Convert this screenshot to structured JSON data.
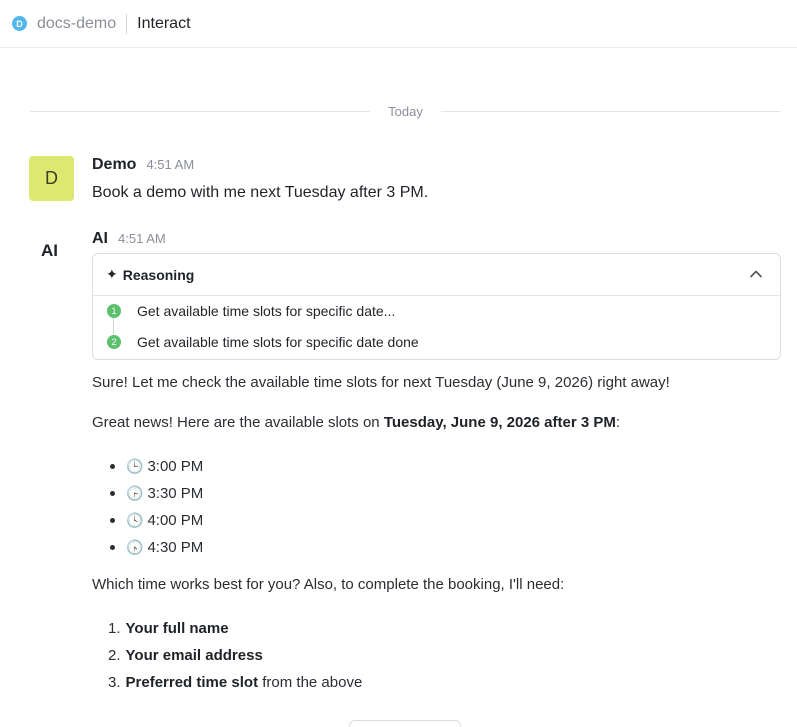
{
  "header": {
    "workspace_initial": "D",
    "workspace_name": "docs-demo",
    "page_name": "Interact"
  },
  "divider": {
    "label": "Today"
  },
  "user_message": {
    "avatar_initial": "D",
    "sender": "Demo",
    "time": "4:51 AM",
    "text": "Book a demo with me next Tuesday after 3 PM."
  },
  "ai_message": {
    "avatar_label": "AI",
    "sender": "AI",
    "time": "4:51 AM",
    "reasoning": {
      "title": "Reasoning",
      "steps": [
        {
          "num": "1",
          "text": "Get available time slots for specific date..."
        },
        {
          "num": "2",
          "text": "Get available time slots for specific date done"
        }
      ]
    },
    "intro": "Sure! Let me check the available time slots for next Tuesday (June 9, 2026) right away!",
    "slots_lead": "Great news! Here are the available slots on ",
    "slots_date": "Tuesday, June 9, 2026 after 3 PM",
    "slots_colon": ":",
    "slots": [
      "3:00 PM",
      "3:30 PM",
      "4:00 PM",
      "4:30 PM"
    ],
    "question": "Which time works best for you? Also, to complete the booking, I'll need:",
    "requirements": [
      {
        "num": "1.",
        "bold": "Your full name",
        "rest": ""
      },
      {
        "num": "2.",
        "bold": "Your email address",
        "rest": ""
      },
      {
        "num": "3.",
        "bold": "Preferred time slot",
        "rest": " from the above"
      }
    ]
  }
}
